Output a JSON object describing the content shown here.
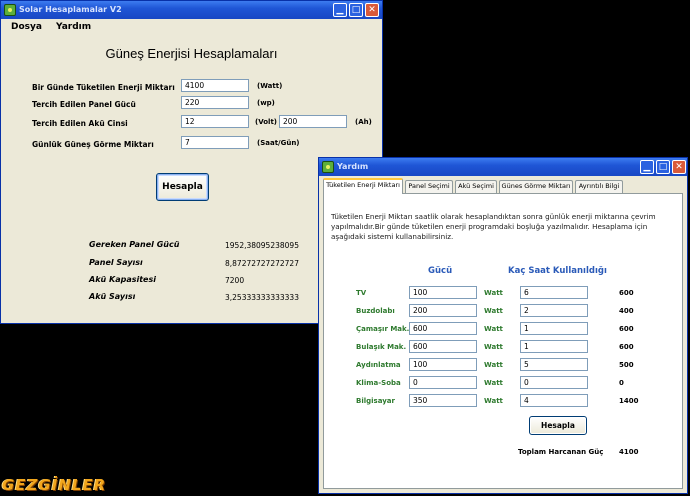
{
  "main_window": {
    "title": "Solar Hesaplamalar V2",
    "menu": [
      "Dosya",
      "Yardım"
    ],
    "heading": "Güneş Enerjisi Hesaplamaları",
    "inputs": [
      {
        "label": "Bir Günde Tüketilen Enerji Miktarı",
        "value": "4100",
        "unit": "(Watt)"
      },
      {
        "label": "Tercih Edilen Panel Gücü",
        "value": "220",
        "unit": "(wp)"
      },
      {
        "label": "Tercih Edilen Akü Cinsi",
        "value": "12",
        "unit": "(Volt)",
        "value2": "200",
        "unit2": "(Ah)"
      },
      {
        "label": "Günlük Güneş Görme Miktarı",
        "value": "7",
        "unit": "(Saat/Gün)"
      }
    ],
    "calculate_label": "Hesapla",
    "results": [
      {
        "label": "Gereken Panel Gücü",
        "value": "1952,38095238095"
      },
      {
        "label": "Panel Sayısı",
        "value": "8,87272727272727"
      },
      {
        "label": "Akü Kapasitesi",
        "value": "7200"
      },
      {
        "label": "Akü Sayısı",
        "value": "3,25333333333333"
      }
    ]
  },
  "help_window": {
    "title": "Yardım",
    "tabs": [
      "Tüketilen Enerji Miktarı",
      "Panel Seçimi",
      "Akü Seçimi",
      "Günes Görme Miktarı",
      "Ayrıntılı Bilgi"
    ],
    "active_tab": 0,
    "description": "Tüketilen Enerji Miktarı saatlik olarak hesaplandıktan sonra günlük enerji miktarına çevrim yapılmalıdır.Bir günde tüketilen enerji programdaki boşluğa yazılmalıdır. Hesaplama için aşağıdaki sistemi kullanabilirsiniz.",
    "col_power": "Gücü",
    "col_hours": "Kaç Saat Kullanıldığı",
    "watt_label": "Watt",
    "devices": [
      {
        "name": "TV",
        "power": "100",
        "hours": "6",
        "total": "600"
      },
      {
        "name": "Buzdolabı",
        "power": "200",
        "hours": "2",
        "total": "400"
      },
      {
        "name": "Çamaşır Mak.",
        "power": "600",
        "hours": "1",
        "total": "600"
      },
      {
        "name": "Bulaşık Mak.",
        "power": "600",
        "hours": "1",
        "total": "600"
      },
      {
        "name": "Aydınlatma",
        "power": "100",
        "hours": "5",
        "total": "500"
      },
      {
        "name": "Klima-Soba",
        "power": "0",
        "hours": "0",
        "total": "0"
      },
      {
        "name": "Bilgisayar",
        "power": "350",
        "hours": "4",
        "total": "1400"
      }
    ],
    "calculate_label": "Hesapla",
    "total_label": "Toplam Harcanan Güç",
    "total_value": "4100"
  },
  "watermark": "GEZGİNLER"
}
